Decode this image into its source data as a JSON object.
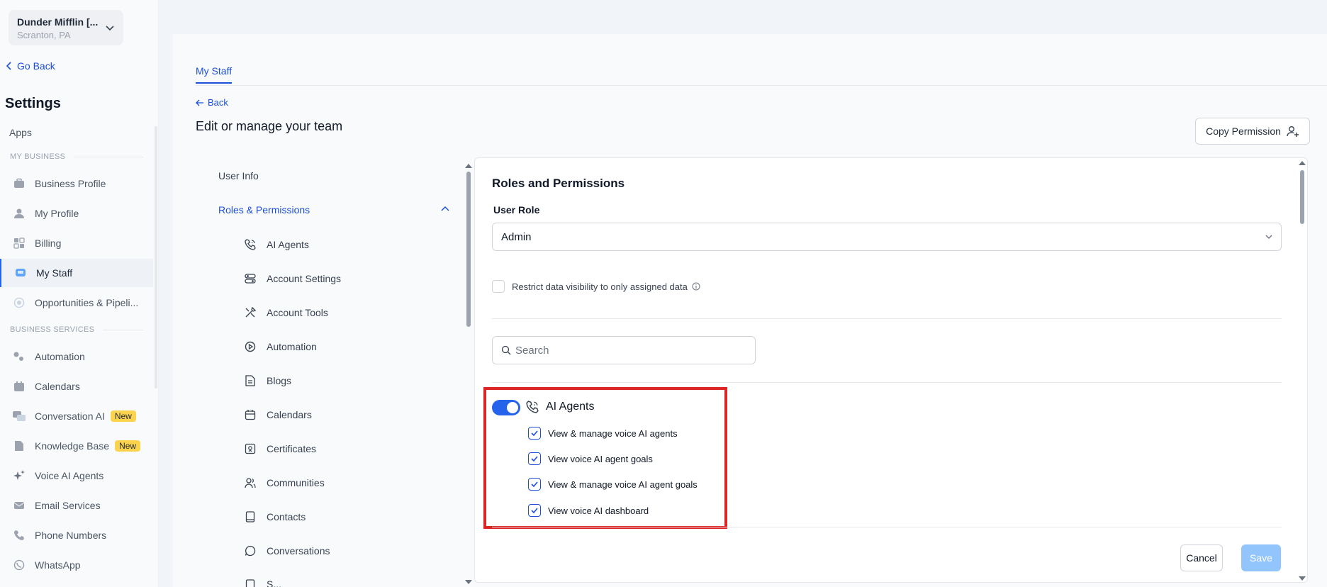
{
  "account": {
    "name": "Dunder Mifflin [...",
    "location": "Scranton, PA"
  },
  "sidebar": {
    "go_back": "Go Back",
    "title": "Settings",
    "apps": "Apps",
    "section_my_business": "MY BUSINESS",
    "section_business_services": "BUSINESS SERVICES",
    "items": [
      {
        "label": "Business Profile",
        "icon": "briefcase-icon"
      },
      {
        "label": "My Profile",
        "icon": "user-icon"
      },
      {
        "label": "Billing",
        "icon": "grid-icon"
      },
      {
        "label": "My Staff",
        "icon": "staff-icon",
        "active": true
      },
      {
        "label": "Opportunities & Pipeli...",
        "icon": "target-icon"
      },
      {
        "label": "Automation",
        "icon": "cogs-icon"
      },
      {
        "label": "Calendars",
        "icon": "calendar-icon"
      },
      {
        "label": "Conversation AI",
        "icon": "chat-icon",
        "badge": "New"
      },
      {
        "label": "Knowledge Base",
        "icon": "document-icon",
        "badge": "New"
      },
      {
        "label": "Voice AI Agents",
        "icon": "sparkle-icon"
      },
      {
        "label": "Email Services",
        "icon": "mail-icon"
      },
      {
        "label": "Phone Numbers",
        "icon": "phone-icon"
      },
      {
        "label": "WhatsApp",
        "icon": "whatsapp-icon"
      }
    ]
  },
  "main": {
    "tab": "My Staff",
    "back": "Back",
    "title": "Edit or manage your team",
    "copy_permission": "Copy Permission",
    "left_nav": {
      "user_info": "User Info",
      "roles_permissions": "Roles & Permissions",
      "sub_items": [
        "AI Agents",
        "Account Settings",
        "Account Tools",
        "Automation",
        "Blogs",
        "Calendars",
        "Certificates",
        "Communities",
        "Contacts",
        "Conversations",
        "S..."
      ]
    },
    "panel": {
      "title": "Roles and Permissions",
      "user_role_label": "User Role",
      "user_role_value": "Admin",
      "restrict_label": "Restrict data visibility to only assigned data",
      "search_placeholder": "Search",
      "group_title": "AI Agents",
      "group_enabled": true,
      "permissions": [
        "View & manage voice AI agents",
        "View voice AI agent goals",
        "View & manage voice AI agent goals",
        "View voice AI dashboard"
      ],
      "cancel": "Cancel",
      "save": "Save"
    }
  },
  "colors": {
    "accent": "#2563eb",
    "highlight_border": "#dc2626",
    "badge": "#fcd34d"
  }
}
